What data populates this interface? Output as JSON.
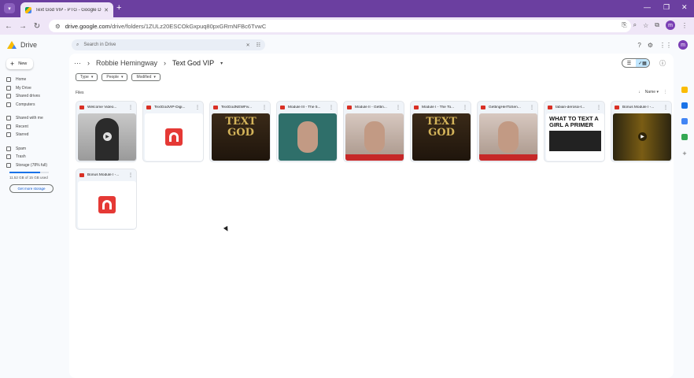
{
  "browser": {
    "tab_title": "Text God VIP - PTG - Google Drive",
    "url_host": "drive.google.com",
    "url_path": "/drive/folders/1ZULz20ESCOkGxpuq80pxGRmNFBc6TvwC",
    "profile_initial": "m"
  },
  "drive": {
    "app_name": "Drive",
    "new_label": "New",
    "search_placeholder": "Search in Drive",
    "sidebar": [
      {
        "label": "Home"
      },
      {
        "label": "My Drive"
      },
      {
        "label": "Shared drives"
      },
      {
        "label": "Computers"
      },
      {
        "label": "Shared with me"
      },
      {
        "label": "Recent"
      },
      {
        "label": "Starred"
      },
      {
        "label": "Spam"
      },
      {
        "label": "Trash"
      },
      {
        "label": "Storage (78% full)"
      }
    ],
    "storage_percent": 78,
    "storage_text": "11.52 GB of 15 GB used",
    "get_storage_label": "Get more storage",
    "breadcrumb": {
      "parent": "Robbie Hemingway",
      "current": "Text God VIP"
    },
    "filters": [
      "Type",
      "People",
      "Modified"
    ],
    "files_label": "Files",
    "sort_label": "Name",
    "files": [
      {
        "name": "Welcome Video...",
        "kind": "video"
      },
      {
        "name": "TextGodVIP-Digi...",
        "kind": "pdf"
      },
      {
        "name": "TextGodNEWFiv...",
        "kind": "gold"
      },
      {
        "name": "Module III - The 5...",
        "kind": "teal"
      },
      {
        "name": "Module II - Gettin...",
        "kind": "girl"
      },
      {
        "name": "Module I - The To...",
        "kind": "gold"
      },
      {
        "name": "GettingHerToSen...",
        "kind": "girl"
      },
      {
        "name": "fabian-derosoi-t...",
        "kind": "book"
      },
      {
        "name": "Bonus Module I -...",
        "kind": "dark"
      },
      {
        "name": "Bonus Module I -...",
        "kind": "pdf"
      }
    ],
    "gold_text": "TEXT GOD",
    "book_text": "WHAT TO TEXT A GIRL A PRIMER"
  }
}
